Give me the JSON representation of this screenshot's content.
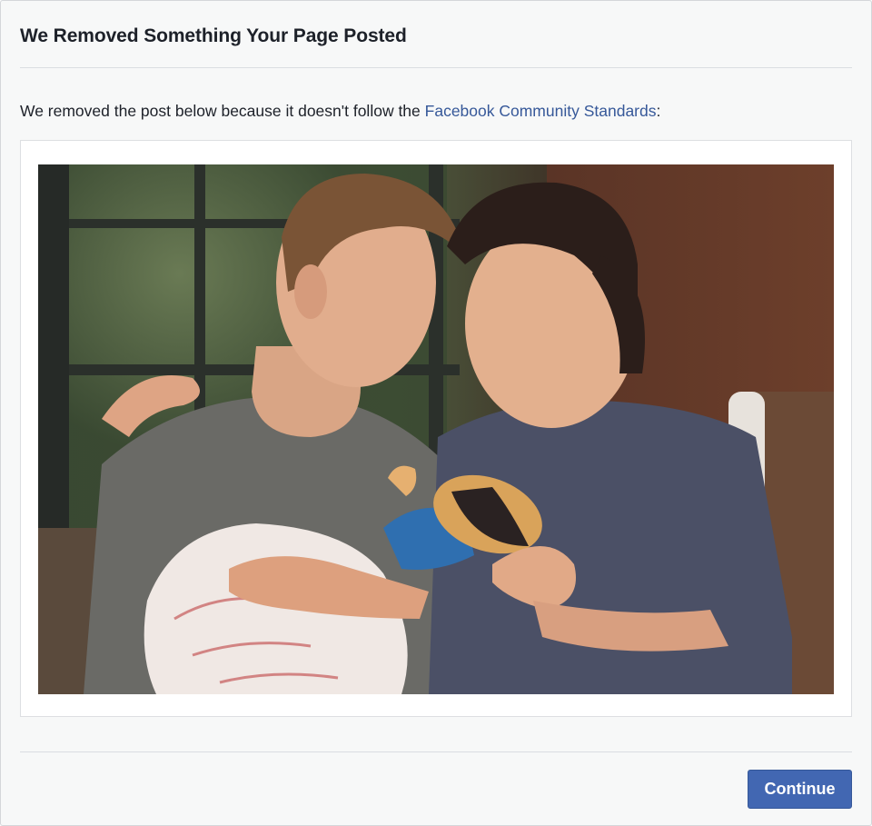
{
  "dialog": {
    "title": "We Removed Something Your Page Posted",
    "message_prefix": "We removed the post below because it doesn't follow the ",
    "link_text": "Facebook Community Standards",
    "message_suffix": ":"
  },
  "post": {
    "image_icon": "photo"
  },
  "footer": {
    "continue_label": "Continue"
  },
  "colors": {
    "link": "#365899",
    "primary_button": "#4267b2",
    "dialog_background": "#f7f8f8"
  }
}
